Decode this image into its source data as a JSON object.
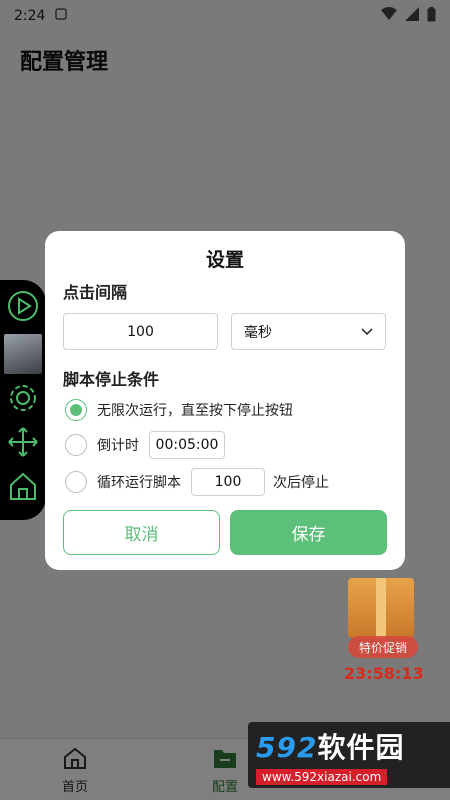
{
  "status_bar": {
    "time": "2:24"
  },
  "page": {
    "title": "配置管理"
  },
  "bottom_nav": {
    "items": [
      {
        "label": "首页"
      },
      {
        "label": "配置"
      },
      {
        "label": ""
      }
    ]
  },
  "promo": {
    "badge": "特价促销",
    "timer": "23:58:13"
  },
  "watermark": {
    "brand_num": "592",
    "brand_cn": "软件园",
    "url": "www.592xiazai.com"
  },
  "dialog": {
    "title": "设置",
    "interval_label": "点击间隔",
    "interval_value": "100",
    "unit_selected": "毫秒",
    "stop_condition_label": "脚本停止条件",
    "options": [
      {
        "label": "无限次运行，直至按下停止按钮",
        "checked": true
      },
      {
        "label": "倒计时",
        "value": "00:05:00",
        "checked": false
      },
      {
        "label": "循环运行脚本",
        "value": "100",
        "suffix": "次后停止",
        "checked": false
      }
    ],
    "cancel_label": "取消",
    "save_label": "保存"
  },
  "colors": {
    "accent": "#5cbf7a",
    "nav_active": "#2f7a3a",
    "timer": "#d82b1c"
  }
}
